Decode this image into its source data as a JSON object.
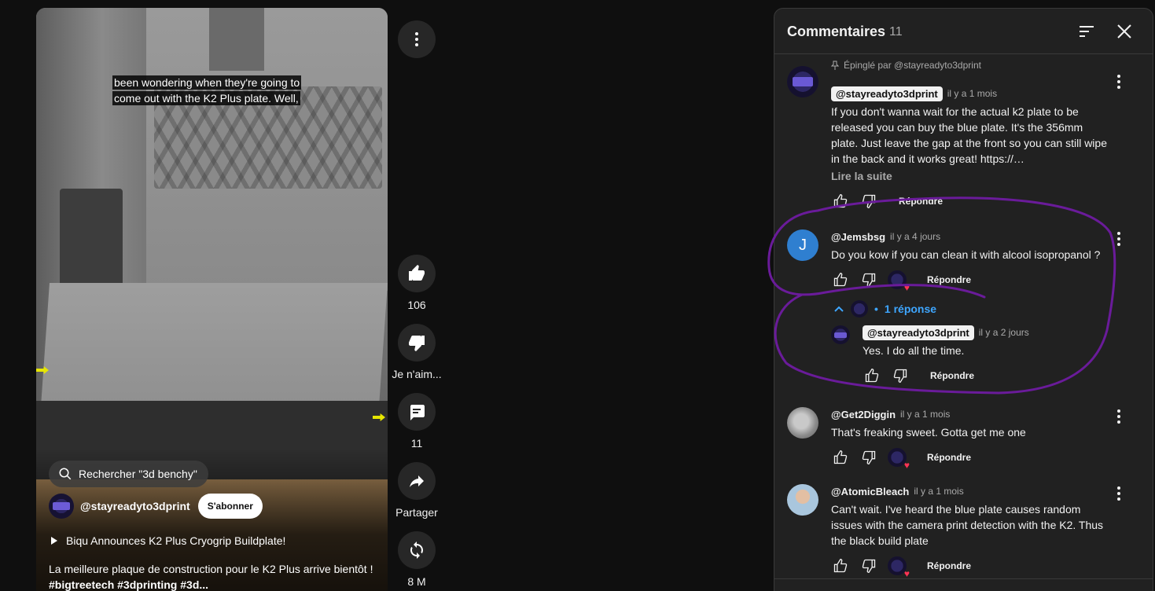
{
  "video": {
    "caption": "been wondering when they're going to come out with the K2 Plus plate. Well,",
    "search_chip": "Rechercher \"3d benchy\"",
    "channel_name": "@stayreadyto3dprint",
    "subscribe_label": "S'abonner",
    "title": "Biqu Announces K2 Plus Cryogrip Buildplate!",
    "description": "La meilleure plaque de construction pour le K2 Plus arrive bientôt !",
    "hashtags": "#bigtreetech #3dprinting #3d..."
  },
  "actions": {
    "like_count": "106",
    "dislike_label": "Je n'aim...",
    "comments_count": "11",
    "share_label": "Partager",
    "remix_count": "8 M"
  },
  "comments_panel": {
    "title": "Commentaires",
    "count": "11",
    "reply_label": "Répondre",
    "read_more": "Lire la suite",
    "replies_toggle": "1 réponse",
    "comments": [
      {
        "pinned_by": "Épinglé par @stayreadyto3dprint",
        "author": "@stayreadyto3dprint",
        "time": "il y a 1 mois",
        "text": "If you don't wanna wait for the actual k2 plate to be released you can buy the blue plate. It's the 356mm plate. Just leave the gap at the front so you can still wipe in the back and it works great! https://…"
      },
      {
        "author": "@Jemsbsg",
        "avatar_letter": "J",
        "time": "il y a 4 jours",
        "text": "Do you kow if you can clean it with alcool isopropanol ?"
      },
      {
        "author": "@stayreadyto3dprint",
        "time": "il y a 2 jours",
        "text": "Yes. I do all the time."
      },
      {
        "author": "@Get2Diggin",
        "time": "il y a 1 mois",
        "text": "That's freaking sweet. Gotta get me one"
      },
      {
        "author": "@AtomicBleach",
        "time": "il y a 1 mois",
        "text": "Can't wait. I've heard the blue plate causes random issues with the camera print detection with the K2. Thus the black build plate"
      }
    ]
  },
  "colors": {
    "background": "#0f0f0f",
    "panel": "#212121",
    "link_blue": "#3ea6ff",
    "annotation_purple": "#6a1b9a",
    "heart": "#ff3355"
  }
}
